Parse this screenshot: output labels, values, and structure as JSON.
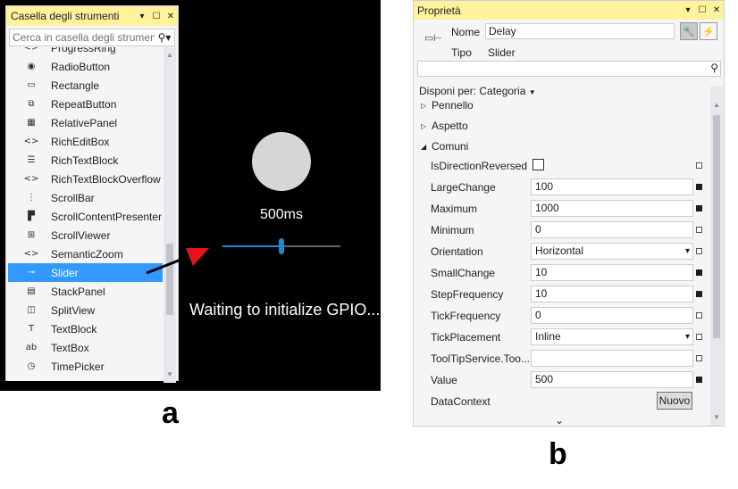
{
  "toolbox": {
    "title": "Casella degli strumenti",
    "search_placeholder": "Cerca in casella degli strumenti",
    "items": [
      {
        "label": "ProgressRing",
        "icon": "code-icon"
      },
      {
        "label": "RadioButton",
        "icon": "radio-icon"
      },
      {
        "label": "Rectangle",
        "icon": "rectangle-icon"
      },
      {
        "label": "RepeatButton",
        "icon": "repeat-button-icon"
      },
      {
        "label": "RelativePanel",
        "icon": "relative-panel-icon"
      },
      {
        "label": "RichEditBox",
        "icon": "code-icon"
      },
      {
        "label": "RichTextBlock",
        "icon": "rich-text-icon"
      },
      {
        "label": "RichTextBlockOverflow",
        "icon": "code-icon"
      },
      {
        "label": "ScrollBar",
        "icon": "scrollbar-icon"
      },
      {
        "label": "ScrollContentPresenter",
        "icon": "scroll-presenter-icon"
      },
      {
        "label": "ScrollViewer",
        "icon": "scroll-viewer-icon"
      },
      {
        "label": "SemanticZoom",
        "icon": "code-icon"
      },
      {
        "label": "Slider",
        "icon": "slider-icon",
        "selected": true
      },
      {
        "label": "StackPanel",
        "icon": "stack-panel-icon"
      },
      {
        "label": "SplitView",
        "icon": "split-view-icon"
      },
      {
        "label": "TextBlock",
        "icon": "text-block-icon"
      },
      {
        "label": "TextBox",
        "icon": "text-box-icon"
      },
      {
        "label": "TimePicker",
        "icon": "time-picker-icon"
      }
    ]
  },
  "preview": {
    "delay_text": "500ms",
    "status_text": "Waiting to initialize GPIO...",
    "slider_value_fraction": 0.5
  },
  "figure_labels": {
    "a": "a",
    "b": "b"
  },
  "properties": {
    "title": "Proprietà",
    "name_label": "Nome",
    "name_value": "Delay",
    "type_label": "Tipo",
    "type_value": "Slider",
    "arrange_by": "Disponi per: Categoria",
    "categories": {
      "brush": "Pennello",
      "appearance": "Aspetto",
      "common": "Comuni"
    },
    "rows": [
      {
        "name": "IsDirectionReversed",
        "kind": "checkbox",
        "value": "",
        "set": false
      },
      {
        "name": "LargeChange",
        "kind": "text",
        "value": "100",
        "set": true
      },
      {
        "name": "Maximum",
        "kind": "text",
        "value": "1000",
        "set": true
      },
      {
        "name": "Minimum",
        "kind": "text",
        "value": "0",
        "set": false
      },
      {
        "name": "Orientation",
        "kind": "combo",
        "value": "Horizontal",
        "set": false
      },
      {
        "name": "SmallChange",
        "kind": "text",
        "value": "10",
        "set": true
      },
      {
        "name": "StepFrequency",
        "kind": "text",
        "value": "10",
        "set": true
      },
      {
        "name": "TickFrequency",
        "kind": "text",
        "value": "0",
        "set": false
      },
      {
        "name": "TickPlacement",
        "kind": "combo",
        "value": "Inline",
        "set": false
      },
      {
        "name": "ToolTipService.Too...",
        "kind": "text",
        "value": "",
        "set": false
      },
      {
        "name": "Value",
        "kind": "text",
        "value": "500",
        "set": true
      },
      {
        "name": "DataContext",
        "kind": "button",
        "value": "Nuovo",
        "set": false
      }
    ]
  },
  "colors": {
    "title_bar": "#fff29d",
    "selection": "#3399ff",
    "accent": "#1a8ad8",
    "arrow": "#e8141c"
  }
}
